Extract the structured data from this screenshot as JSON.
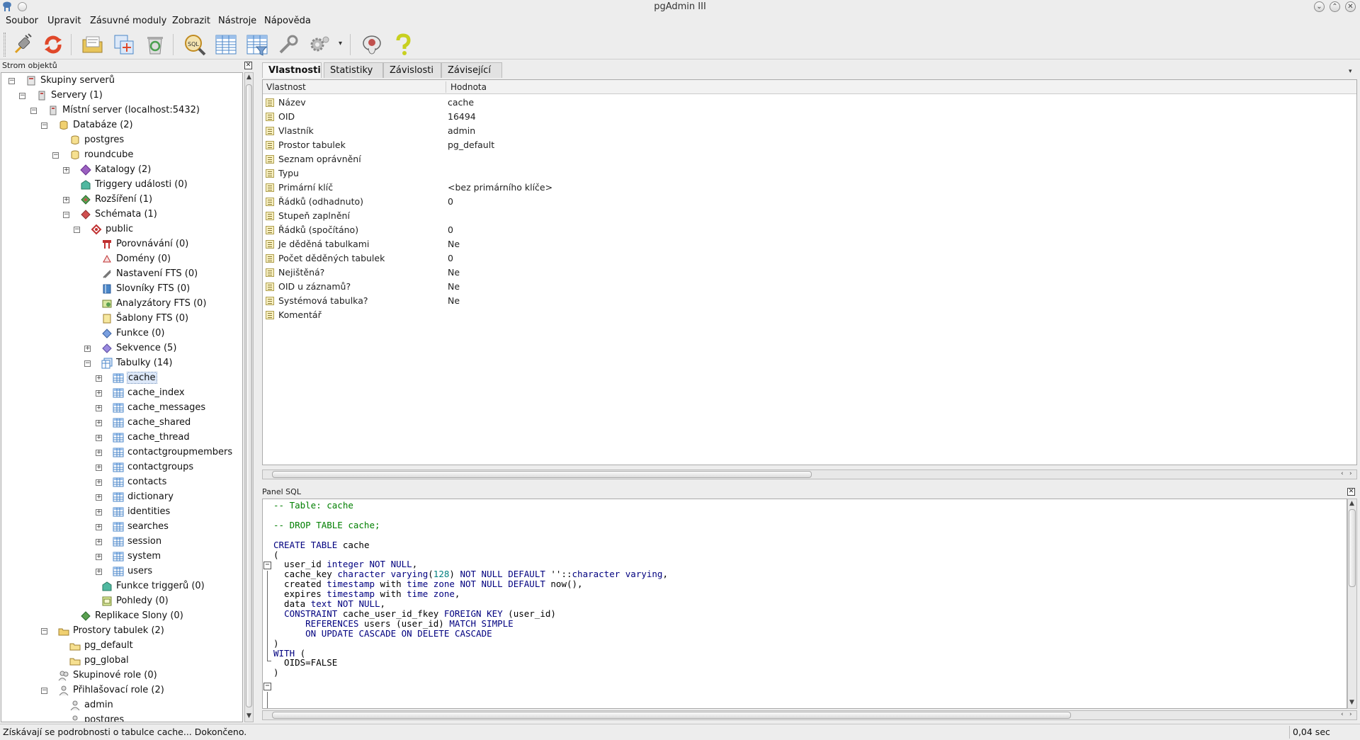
{
  "window": {
    "title": "pgAdmin III",
    "controls": [
      "⌄",
      "⌃",
      "✕"
    ]
  },
  "menu": [
    "Soubor",
    "Upravit",
    "Zásuvné moduly",
    "Zobrazit",
    "Nástroje",
    "Nápověda"
  ],
  "toolbar": {
    "buttons": [
      {
        "name": "connect-plug-icon",
        "color": "#8a8a8a"
      },
      {
        "name": "refresh-icon",
        "color": "#e0482a"
      },
      {
        "name": "properties-folder-icon",
        "color": "#e8c55a"
      },
      {
        "name": "create-object-icon",
        "color": "#4a86c8"
      },
      {
        "name": "drop-recycle-icon",
        "color": "#4aa050"
      },
      {
        "name": "sql-query-icon",
        "color": "#e0a020"
      },
      {
        "name": "view-data-icon",
        "color": "#4a86c8"
      },
      {
        "name": "filtered-data-icon",
        "color": "#4a86c8"
      },
      {
        "name": "maintenance-wrench-icon",
        "color": "#8a8a8a"
      },
      {
        "name": "plugins-gear-icon",
        "color": "#9a9a9a"
      },
      {
        "name": "hint-elephant-icon",
        "color": "#c0504d"
      },
      {
        "name": "help-question-icon",
        "color": "#c8d020"
      }
    ],
    "dropdown_arrow": "▾"
  },
  "tree_panel": {
    "title": "Strom objektů",
    "close": "✕",
    "nodes": [
      {
        "label": "Skupiny serverů",
        "level": 0,
        "exp": "−",
        "icon": "server-group"
      },
      {
        "label": "Servery (1)",
        "level": 1,
        "exp": "−",
        "icon": "servers"
      },
      {
        "label": "Místní server (localhost:5432)",
        "level": 2,
        "exp": "−",
        "icon": "server"
      },
      {
        "label": "Databáze (2)",
        "level": 3,
        "exp": "−",
        "icon": "databases"
      },
      {
        "label": "postgres",
        "level": 4,
        "exp": "",
        "icon": "database"
      },
      {
        "label": "roundcube",
        "level": 4,
        "exp": "−",
        "icon": "database"
      },
      {
        "label": "Katalogy (2)",
        "level": 5,
        "exp": "+",
        "icon": "catalog"
      },
      {
        "label": "Triggery události (0)",
        "level": 5,
        "exp": "",
        "icon": "event-trigger"
      },
      {
        "label": "Rozšíření (1)",
        "level": 5,
        "exp": "+",
        "icon": "extension"
      },
      {
        "label": "Schémata (1)",
        "level": 5,
        "exp": "−",
        "icon": "schemas"
      },
      {
        "label": "public",
        "level": 6,
        "exp": "−",
        "icon": "schema"
      },
      {
        "label": "Porovnávání (0)",
        "level": 7,
        "exp": "",
        "icon": "collation"
      },
      {
        "label": "Domény (0)",
        "level": 7,
        "exp": "",
        "icon": "domain"
      },
      {
        "label": "Nastavení FTS (0)",
        "level": 7,
        "exp": "",
        "icon": "fts-config"
      },
      {
        "label": "Slovníky FTS (0)",
        "level": 7,
        "exp": "",
        "icon": "fts-dictionary"
      },
      {
        "label": "Analyzátory FTS (0)",
        "level": 7,
        "exp": "",
        "icon": "fts-parser"
      },
      {
        "label": "Šablony FTS (0)",
        "level": 7,
        "exp": "",
        "icon": "fts-template"
      },
      {
        "label": "Funkce (0)",
        "level": 7,
        "exp": "",
        "icon": "function"
      },
      {
        "label": "Sekvence (5)",
        "level": 7,
        "exp": "+",
        "icon": "sequence"
      },
      {
        "label": "Tabulky (14)",
        "level": 7,
        "exp": "−",
        "icon": "tables"
      },
      {
        "label": "cache",
        "level": 8,
        "exp": "+",
        "icon": "table",
        "selected": true
      },
      {
        "label": "cache_index",
        "level": 8,
        "exp": "+",
        "icon": "table"
      },
      {
        "label": "cache_messages",
        "level": 8,
        "exp": "+",
        "icon": "table"
      },
      {
        "label": "cache_shared",
        "level": 8,
        "exp": "+",
        "icon": "table"
      },
      {
        "label": "cache_thread",
        "level": 8,
        "exp": "+",
        "icon": "table"
      },
      {
        "label": "contactgroupmembers",
        "level": 8,
        "exp": "+",
        "icon": "table"
      },
      {
        "label": "contactgroups",
        "level": 8,
        "exp": "+",
        "icon": "table"
      },
      {
        "label": "contacts",
        "level": 8,
        "exp": "+",
        "icon": "table"
      },
      {
        "label": "dictionary",
        "level": 8,
        "exp": "+",
        "icon": "table"
      },
      {
        "label": "identities",
        "level": 8,
        "exp": "+",
        "icon": "table"
      },
      {
        "label": "searches",
        "level": 8,
        "exp": "+",
        "icon": "table"
      },
      {
        "label": "session",
        "level": 8,
        "exp": "+",
        "icon": "table"
      },
      {
        "label": "system",
        "level": 8,
        "exp": "+",
        "icon": "table"
      },
      {
        "label": "users",
        "level": 8,
        "exp": "+",
        "icon": "table"
      },
      {
        "label": "Funkce triggerů (0)",
        "level": 7,
        "exp": "",
        "icon": "trigger-function"
      },
      {
        "label": "Pohledy (0)",
        "level": 7,
        "exp": "",
        "icon": "view"
      },
      {
        "label": "Replikace Slony (0)",
        "level": 5,
        "exp": "",
        "icon": "slony"
      },
      {
        "label": "Prostory tabulek (2)",
        "level": 3,
        "exp": "−",
        "icon": "tablespaces"
      },
      {
        "label": "pg_default",
        "level": 4,
        "exp": "",
        "icon": "tablespace"
      },
      {
        "label": "pg_global",
        "level": 4,
        "exp": "",
        "icon": "tablespace"
      },
      {
        "label": "Skupinové role (0)",
        "level": 3,
        "exp": "",
        "icon": "group-roles"
      },
      {
        "label": "Přihlašovací role (2)",
        "level": 3,
        "exp": "−",
        "icon": "login-roles"
      },
      {
        "label": "admin",
        "level": 4,
        "exp": "",
        "icon": "user"
      },
      {
        "label": "postgres",
        "level": 4,
        "exp": "",
        "icon": "user"
      }
    ]
  },
  "tabs": [
    "Vlastnosti",
    "Statistiky",
    "Závislosti",
    "Závisející"
  ],
  "tabs_menu": "▾",
  "properties": {
    "col_property": "Vlastnost",
    "col_value": "Hodnota",
    "rows": [
      {
        "name": "Název",
        "value": "cache"
      },
      {
        "name": "OID",
        "value": "16494"
      },
      {
        "name": "Vlastník",
        "value": "admin"
      },
      {
        "name": "Prostor tabulek",
        "value": "pg_default"
      },
      {
        "name": "Seznam oprávnění",
        "value": ""
      },
      {
        "name": "Typu",
        "value": ""
      },
      {
        "name": "Primární klíč",
        "value": "<bez primárního klíče>"
      },
      {
        "name": "Řádků (odhadnuto)",
        "value": "0"
      },
      {
        "name": "Stupeň zaplnění",
        "value": ""
      },
      {
        "name": "Řádků (spočítáno)",
        "value": "0"
      },
      {
        "name": "Je děděná tabulkami",
        "value": "Ne"
      },
      {
        "name": "Počet děděných tabulek",
        "value": "0"
      },
      {
        "name": "Nejištěná?",
        "value": "Ne"
      },
      {
        "name": "OID u záznamů?",
        "value": "Ne"
      },
      {
        "name": "Systémová tabulka?",
        "value": "Ne"
      },
      {
        "name": "Komentář",
        "value": ""
      }
    ]
  },
  "sql_panel": {
    "title": "Panel SQL",
    "close": "✕",
    "lines": [
      "-- Table: cache",
      "",
      "-- DROP TABLE cache;",
      "",
      "CREATE TABLE cache",
      "(",
      "  user_id integer NOT NULL,",
      "  cache_key character varying(128) NOT NULL DEFAULT ''::character varying,",
      "  created timestamp with time zone NOT NULL DEFAULT now(),",
      "  expires timestamp with time zone,",
      "  data text NOT NULL,",
      "  CONSTRAINT cache_user_id_fkey FOREIGN KEY (user_id)",
      "      REFERENCES users (user_id) MATCH SIMPLE",
      "      ON UPDATE CASCADE ON DELETE CASCADE",
      ")",
      "WITH (",
      "  OIDS=FALSE",
      ")"
    ]
  },
  "status": {
    "message": "Získávají se podrobnosti o tabulce cache... Dokončeno.",
    "time": "0,04 sec"
  }
}
